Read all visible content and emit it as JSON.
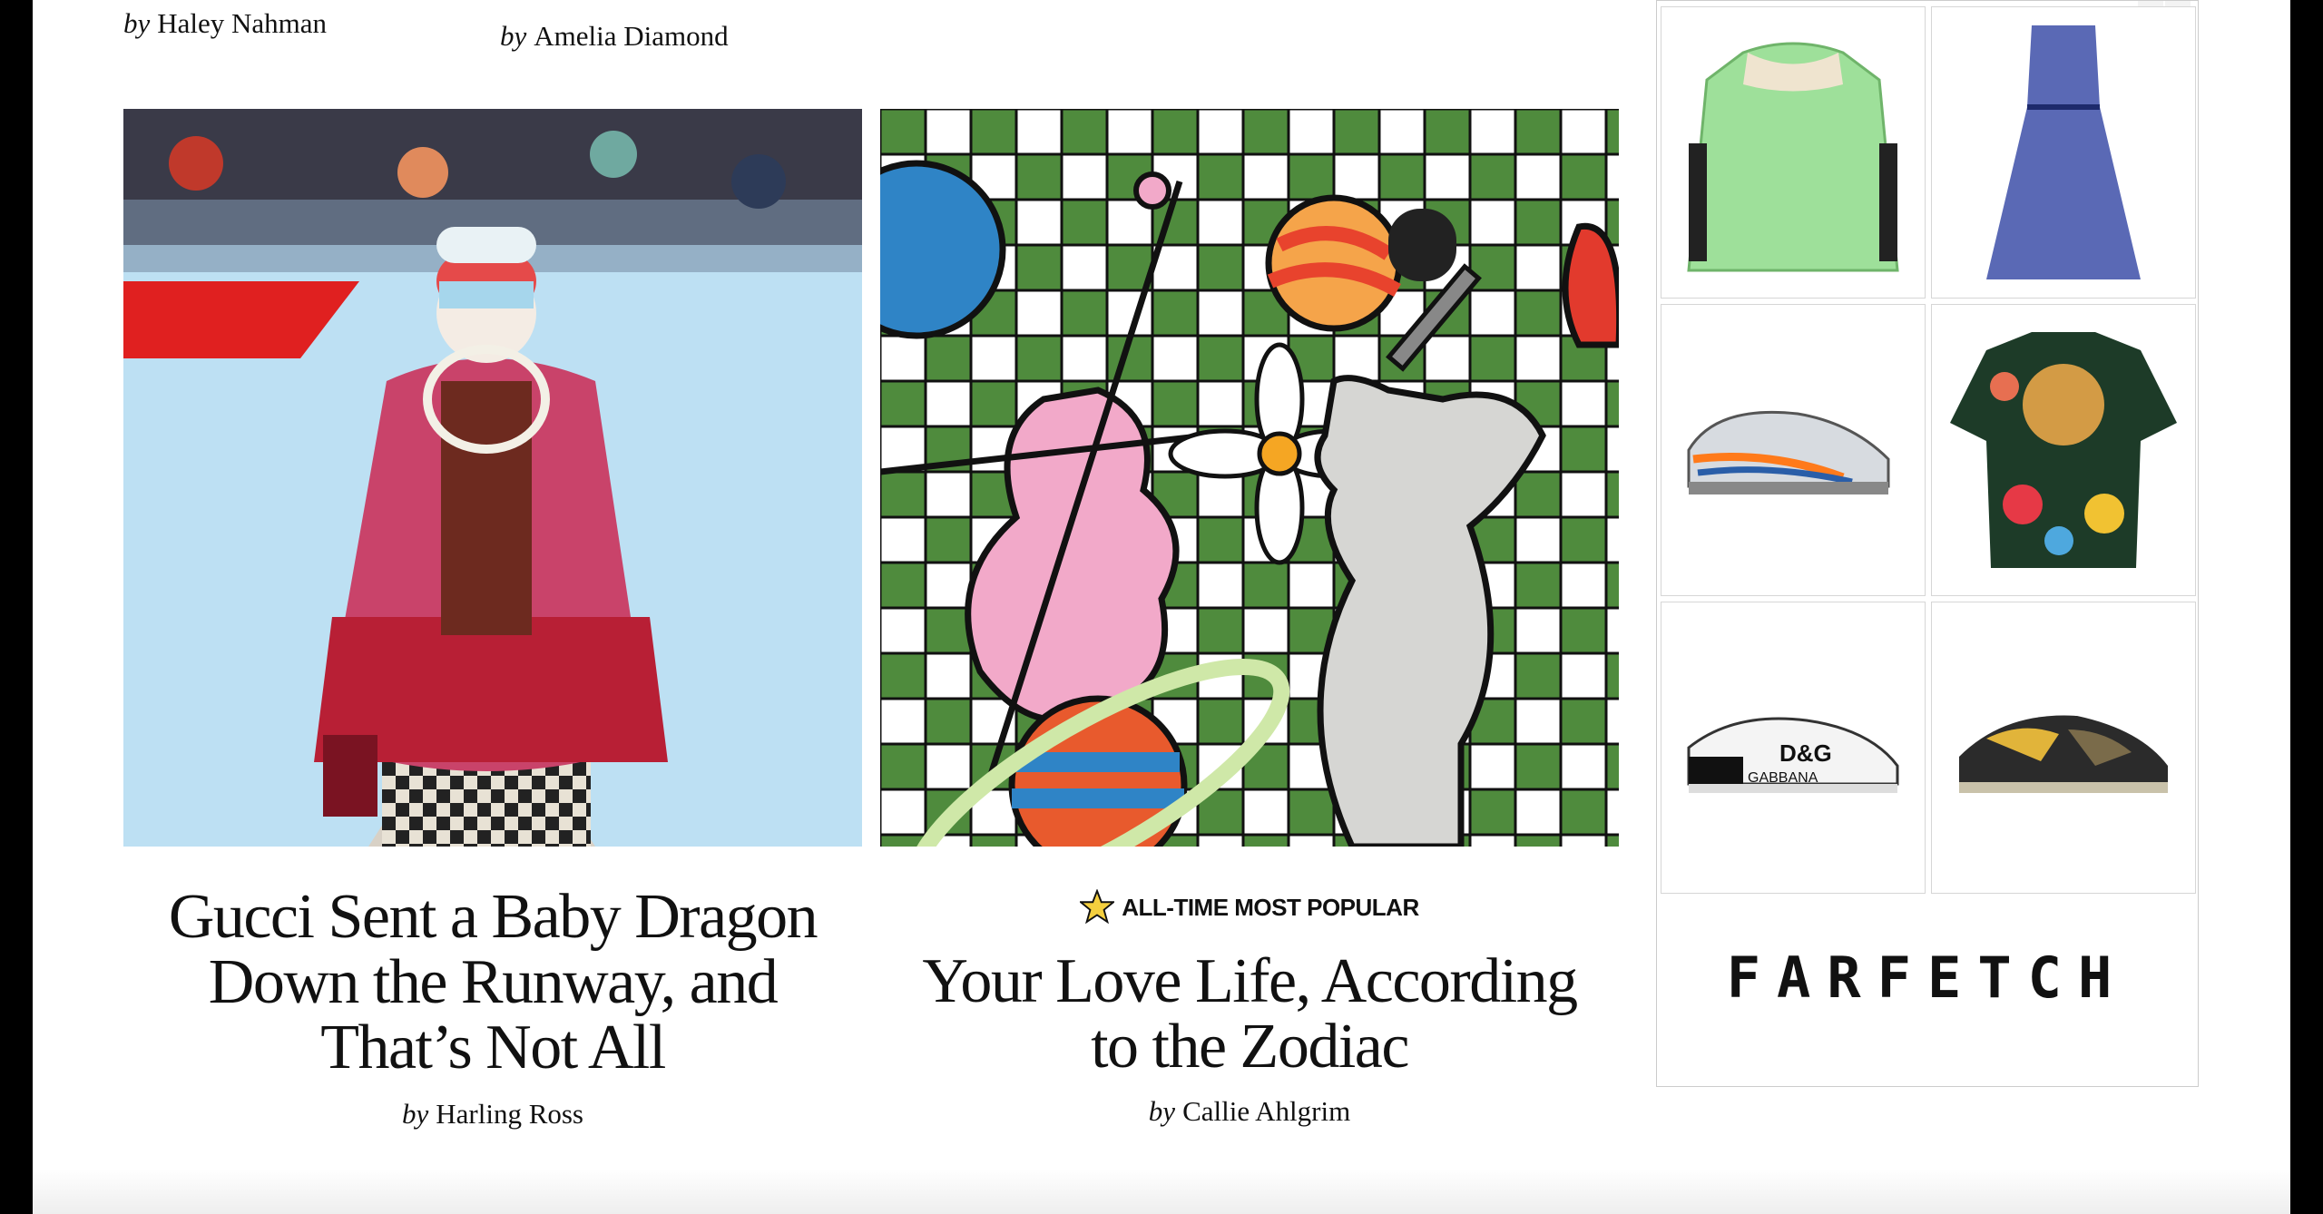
{
  "top_bylines": [
    {
      "by": "by",
      "author": "Haley Nahman"
    },
    {
      "by": "by",
      "author": "Amelia Diamond"
    }
  ],
  "articles": [
    {
      "title_lines": [
        "Gucci Sent a Baby Dragon",
        "Down the Runway, and",
        "That’s Not All"
      ],
      "by": "by",
      "author": "Harling Ross"
    },
    {
      "badge": "ALL-TIME MOST POPULAR",
      "title_lines": [
        "Your Love Life, According",
        "to the Zodiac"
      ],
      "by": "by",
      "author": "Callie Ahlgrim"
    }
  ],
  "ad": {
    "brand": "FARFETCH",
    "products": [
      "green-fur-jacket",
      "navy-tulle-dress",
      "nike-air-max-sneaker",
      "leopard-floral-shirt",
      "dolce-gabbana-logo-sneaker",
      "camouflage-sneaker"
    ],
    "dg_text": "D&G",
    "gabbana_text": "GABBANA"
  },
  "colors": {
    "accent_green": "#4f8b3d",
    "pink": "#f2a9c9",
    "star": "#f4cf3e"
  }
}
